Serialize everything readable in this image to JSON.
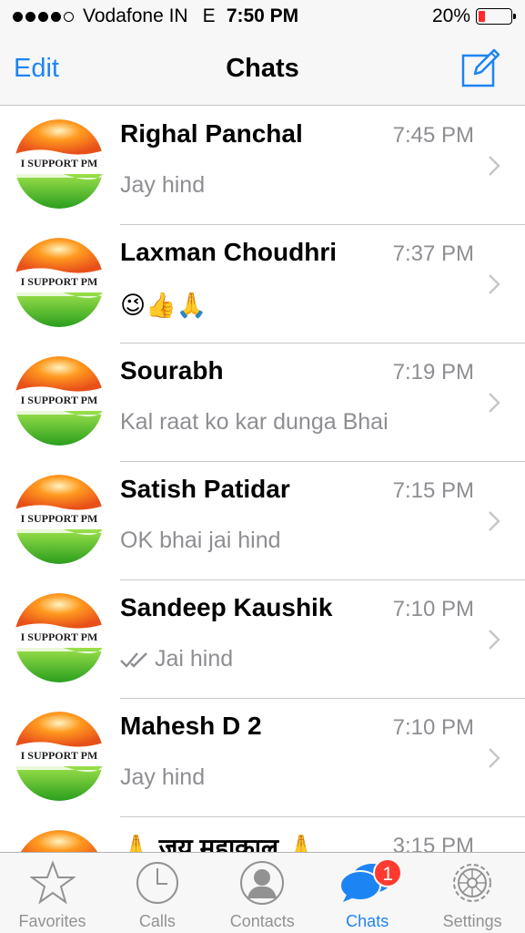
{
  "status_bar": {
    "carrier": "Vodafone IN",
    "network": "E",
    "time": "7:50 PM",
    "battery_percent": "20%",
    "battery_level": 0.2,
    "signal_bars": 4
  },
  "nav": {
    "edit_label": "Edit",
    "title": "Chats",
    "compose_icon": "compose-icon"
  },
  "avatar_text": "I SUPPORT PM",
  "chats": [
    {
      "name": "Righal Panchal",
      "time": "7:45 PM",
      "message": "Jay hind",
      "read_ticks": false,
      "emoji": false
    },
    {
      "name": "Laxman Choudhri",
      "time": "7:37 PM",
      "message": "😉👍🙏",
      "read_ticks": false,
      "emoji": true
    },
    {
      "name": "Sourabh",
      "time": "7:19 PM",
      "message": "Kal raat ko kar dunga Bhai",
      "read_ticks": false,
      "emoji": false
    },
    {
      "name": "Satish Patidar",
      "time": "7:15 PM",
      "message": "OK bhai jai hind",
      "read_ticks": false,
      "emoji": false
    },
    {
      "name": "Sandeep Kaushik",
      "time": "7:10 PM",
      "message": "Jai hind",
      "read_ticks": true,
      "emoji": false
    },
    {
      "name": "Mahesh D 2",
      "time": "7:10 PM",
      "message": "Jay hind",
      "read_ticks": false,
      "emoji": false
    },
    {
      "name": "🙏 जय महाकाल 🙏",
      "time": "3:15 PM",
      "message": "",
      "read_ticks": false,
      "emoji": false
    }
  ],
  "tabs": [
    {
      "label": "Favorites",
      "icon": "star-icon",
      "active": false
    },
    {
      "label": "Calls",
      "icon": "clock-icon",
      "active": false
    },
    {
      "label": "Contacts",
      "icon": "person-icon",
      "active": false
    },
    {
      "label": "Chats",
      "icon": "chat-bubbles-icon",
      "active": true,
      "badge": "1"
    },
    {
      "label": "Settings",
      "icon": "gear-icon",
      "active": false
    }
  ],
  "colors": {
    "accent": "#1d84f3",
    "badge": "#ff3b30",
    "secondary_text": "#8e8e93",
    "battery_low": "#ff2a2a"
  }
}
